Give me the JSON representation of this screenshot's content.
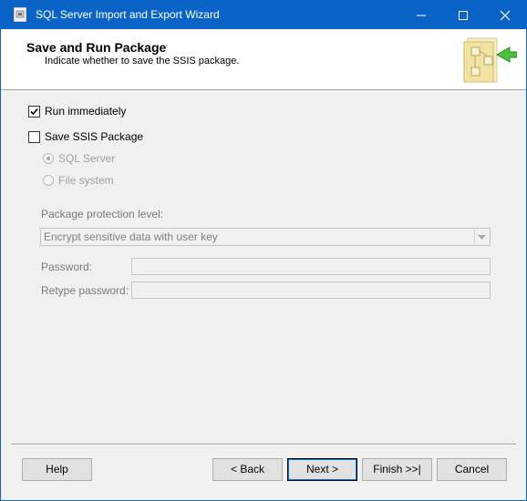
{
  "window": {
    "title": "SQL Server Import and Export Wizard",
    "accent_color": "#0a64c8",
    "icons": [
      "app-icon",
      "minimize-icon",
      "maximize-icon",
      "close-icon"
    ]
  },
  "header": {
    "title": "Save and Run Package",
    "subtitle": "Indicate whether to save the SSIS package."
  },
  "options": {
    "run_immediately": {
      "label": "Run immediately",
      "checked": true
    },
    "save_package": {
      "label": "Save SSIS Package",
      "checked": false
    },
    "sql_server": {
      "label": "SQL Server",
      "selected": true,
      "enabled": false
    },
    "file_system": {
      "label": "File system",
      "selected": false,
      "enabled": false
    }
  },
  "protection": {
    "label": "Package protection level:",
    "selected": "Encrypt sensitive data with user key"
  },
  "password": {
    "label": "Password:",
    "value": ""
  },
  "retype_password": {
    "label": "Retype password:",
    "value": ""
  },
  "buttons": {
    "help": "Help",
    "back": "< Back",
    "next": "Next >",
    "finish": "Finish >>|",
    "cancel": "Cancel"
  }
}
